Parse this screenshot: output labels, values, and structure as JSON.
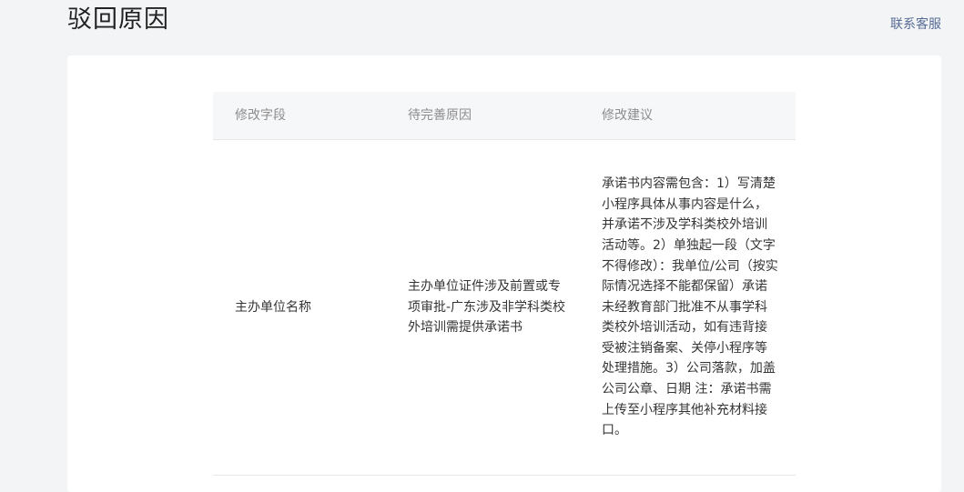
{
  "page": {
    "title": "驳回原因",
    "contact_label": "联系客服"
  },
  "table": {
    "headers": [
      "修改字段",
      "待完善原因",
      "修改建议"
    ],
    "rows": [
      {
        "field": "主办单位名称",
        "reason": "主办单位证件涉及前置或专项审批-广东涉及非学科类校外培训需提供承诺书",
        "suggestion": "承诺书内容需包含：1）写清楚小程序具体从事内容是什么，并承诺不涉及学科类校外培训活动等。2）单独起一段（文字不得修改）：我单位/公司（按实际情况选择不能都保留）承诺未经教育部门批准不从事学科类校外培训活动，如有违背接受被注销备案、关停小程序等处理措施。3）公司落款，加盖公司公章、日期 注：承诺书需上传至小程序其他补充材料接口。"
      }
    ]
  }
}
